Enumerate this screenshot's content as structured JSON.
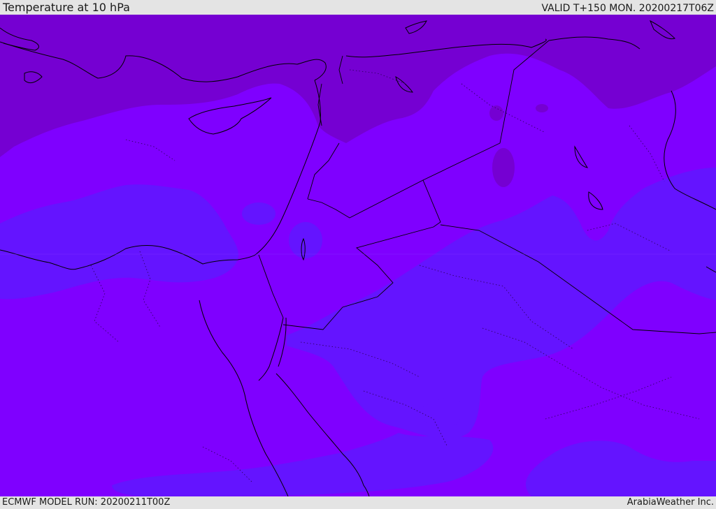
{
  "header": {
    "title": "Temperature at 10 hPa",
    "valid_time": "VALID T+150 MON. 20200217T06Z"
  },
  "footer": {
    "model_run": "ECMWF MODEL RUN: 20200211T00Z",
    "credit": "ArabiaWeather Inc."
  },
  "colors": {
    "background": "#7f00ff",
    "cold_band": "#7500d2",
    "warm_band": "#6414ff",
    "boundary": "#000000",
    "frame": "#e4e4e4"
  }
}
